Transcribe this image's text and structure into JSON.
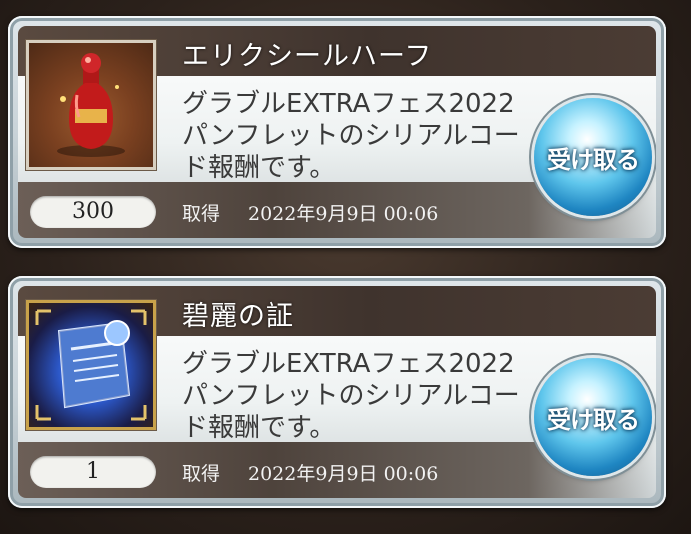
{
  "items": [
    {
      "name": "エリクシールハーフ",
      "description": "グラブルEXTRAフェス2022 パンフレットのシリアルコード報酬です。",
      "quantity": "300",
      "acquired_label": "取得",
      "acquired_time": "2022年9月9日 00:06",
      "button_label": "受け取る",
      "icon": "elixir-half-icon"
    },
    {
      "name": "碧麗の証",
      "description": "グラブルEXTRAフェス2022 パンフレットのシリアルコード報酬です。",
      "quantity": "1",
      "acquired_label": "取得",
      "acquired_time": "2022年9月9日 00:06",
      "button_label": "受け取る",
      "icon": "azure-proof-icon"
    }
  ]
}
